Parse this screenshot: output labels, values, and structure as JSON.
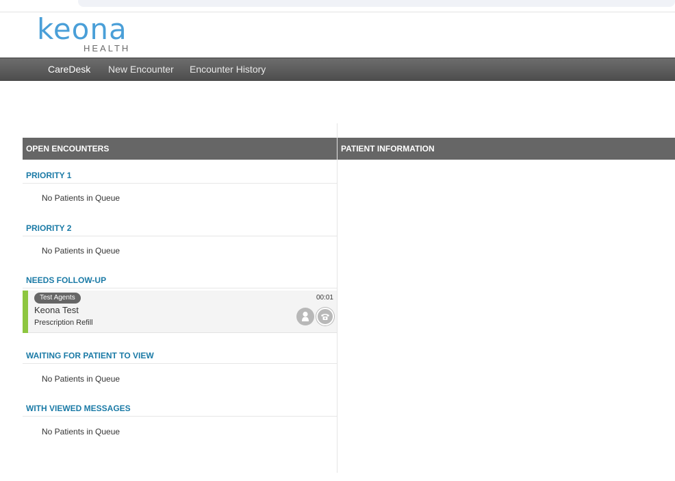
{
  "logo": {
    "wordmark": "keona",
    "subtitle": "HEALTH"
  },
  "nav": {
    "items": [
      {
        "label": "CareDesk",
        "active": true
      },
      {
        "label": "New Encounter",
        "active": false
      },
      {
        "label": "Encounter History",
        "active": false
      }
    ]
  },
  "open_encounters": {
    "header": "OPEN ENCOUNTERS",
    "sections": [
      {
        "title": "PRIORITY 1",
        "empty_text": "No Patients in Queue"
      },
      {
        "title": "PRIORITY 2",
        "empty_text": "No Patients in Queue"
      },
      {
        "title": "NEEDS FOLLOW-UP",
        "encounter": {
          "agent_group": "Test Agents",
          "patient_name": "Keona Test",
          "reason": "Prescription Refill",
          "timer": "00:01",
          "status_color": "#8dc63f",
          "icons": [
            "person-icon",
            "phone-icon"
          ]
        }
      },
      {
        "title": "WAITING FOR PATIENT TO VIEW",
        "empty_text": "No Patients in Queue"
      },
      {
        "title": "WITH VIEWED MESSAGES",
        "empty_text": "No Patients in Queue"
      }
    ]
  },
  "patient_information": {
    "header": "PATIENT INFORMATION"
  },
  "colors": {
    "brand": "#4a9fd8",
    "section_title": "#1a7aa6",
    "header_bg": "#666666",
    "accent_green": "#8dc63f"
  }
}
